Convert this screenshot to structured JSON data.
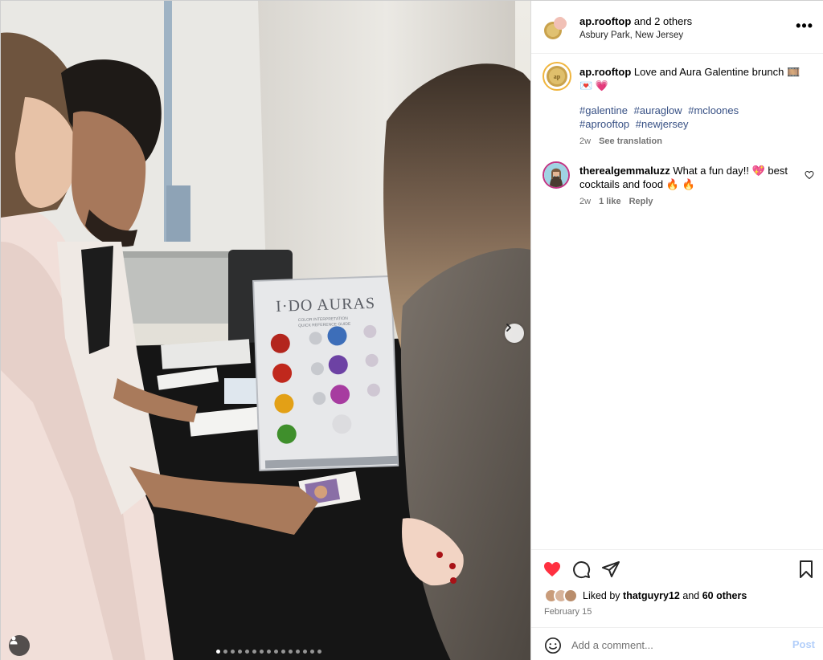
{
  "media": {
    "sign_title": "I·DO AURAS",
    "sign_subtitle_1": "COLOR INTERPRETATION",
    "sign_subtitle_2": "QUICK REFERENCE GUIDE",
    "carousel_count": 15,
    "carousel_active": 0
  },
  "header": {
    "username": "ap.rooftop",
    "collab_text": " and 2 others",
    "location": "Asbury Park, New Jersey",
    "more_label": "•••"
  },
  "caption": {
    "username": "ap.rooftop",
    "text": " Love and Aura Galentine brunch 🎞️ 💌 💗",
    "hashtags": [
      "#galentine",
      "#auraglow",
      "#mcloones",
      "#aprooftop",
      "#newjersey"
    ],
    "time": "2w",
    "translation": "See translation"
  },
  "comment": {
    "username": "therealgemmaluzz",
    "text": " What a fun day!! 💖 best cocktails and food 🔥 🔥",
    "time": "2w",
    "likes": "1 like",
    "reply": "Reply"
  },
  "engagement": {
    "liked_prefix": "Liked by ",
    "liked_user": "thatguyry12",
    "liked_mid": " and ",
    "liked_count": "60 others",
    "date": "February 15"
  },
  "composer": {
    "placeholder": "Add a comment...",
    "post_label": "Post"
  },
  "colors": {
    "like_red": "#ff3040",
    "link_blue": "#385185",
    "post_disabled": "#b3cffa"
  }
}
